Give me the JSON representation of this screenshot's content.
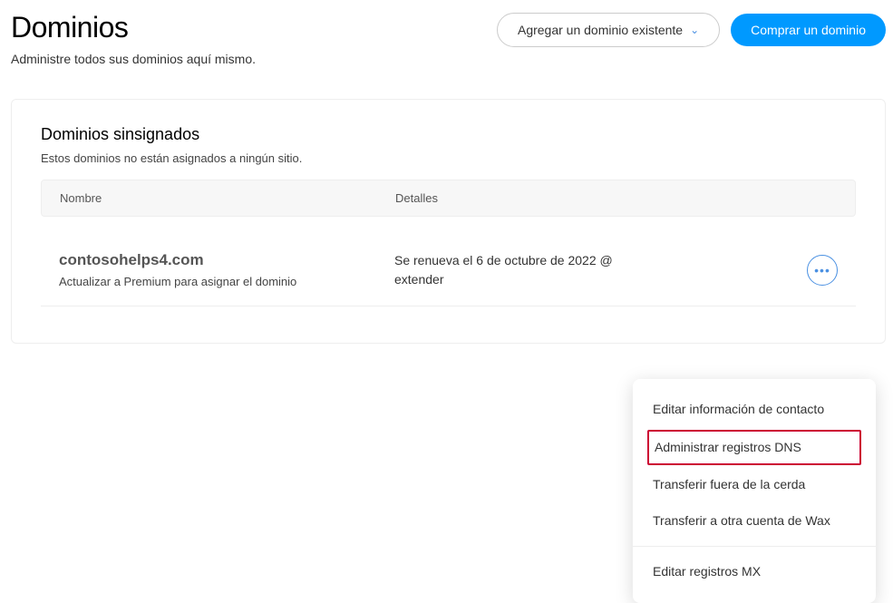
{
  "header": {
    "title": "Dominios",
    "subtitle": "Administre todos sus dominios aquí mismo.",
    "add_existing_label": "Agregar un dominio existente",
    "buy_domain_label": "Comprar un dominio"
  },
  "panel": {
    "title": "Dominios sinsignados",
    "subtitle": "Estos dominios no están asignados a ningún sitio.",
    "columns": {
      "name": "Nombre",
      "details": "Detalles"
    },
    "rows": [
      {
        "domain": "contosohelps4.com",
        "note": "Actualizar a Premium para asignar el dominio",
        "details_line1": "Se renueva el 6 de octubre de 2022 @",
        "details_line2": "extender"
      }
    ]
  },
  "menu": {
    "edit_contact": "Editar información de contacto",
    "manage_dns": "Administrar registros DNS",
    "transfer_out": "Transferir fuera de la cerda",
    "transfer_account": "Transferir a otra cuenta de Wax",
    "edit_mx": "Editar registros MX"
  }
}
